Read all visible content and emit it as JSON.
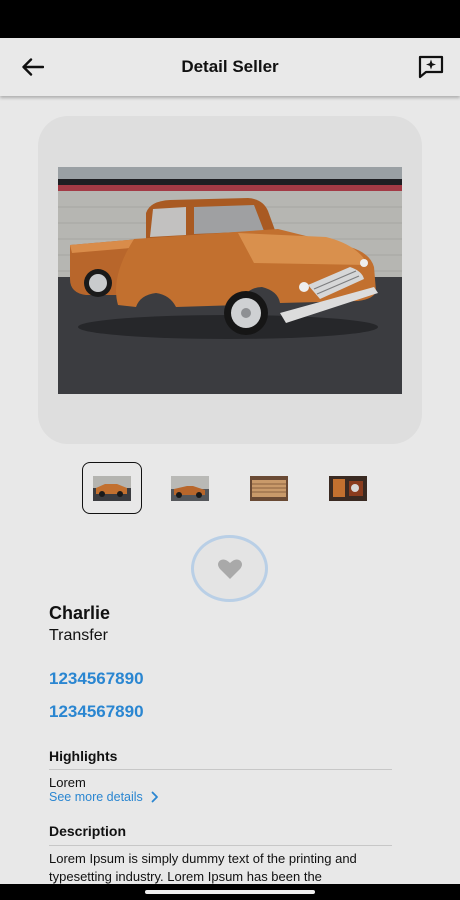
{
  "header": {
    "title": "Detail Seller",
    "back_icon": "arrow-left-icon",
    "message_icon": "message-sparkle-icon"
  },
  "gallery": {
    "selected_index": 0,
    "thumbnail_count": 4
  },
  "favorite": {
    "icon": "heart-icon"
  },
  "seller": {
    "name": "Charlie",
    "subtitle": "Transfer",
    "phones": [
      "1234567890",
      "1234567890"
    ]
  },
  "highlights": {
    "title": "Highlights",
    "text": "Lorem",
    "see_more_label": "See more details"
  },
  "description": {
    "title": "Description",
    "text": "Lorem Ipsum is simply dummy text of the printing and typesetting industry. Lorem Ipsum has been the"
  },
  "colors": {
    "accent": "#2a86d1",
    "background": "#e8e8e8",
    "card": "#dedede"
  }
}
